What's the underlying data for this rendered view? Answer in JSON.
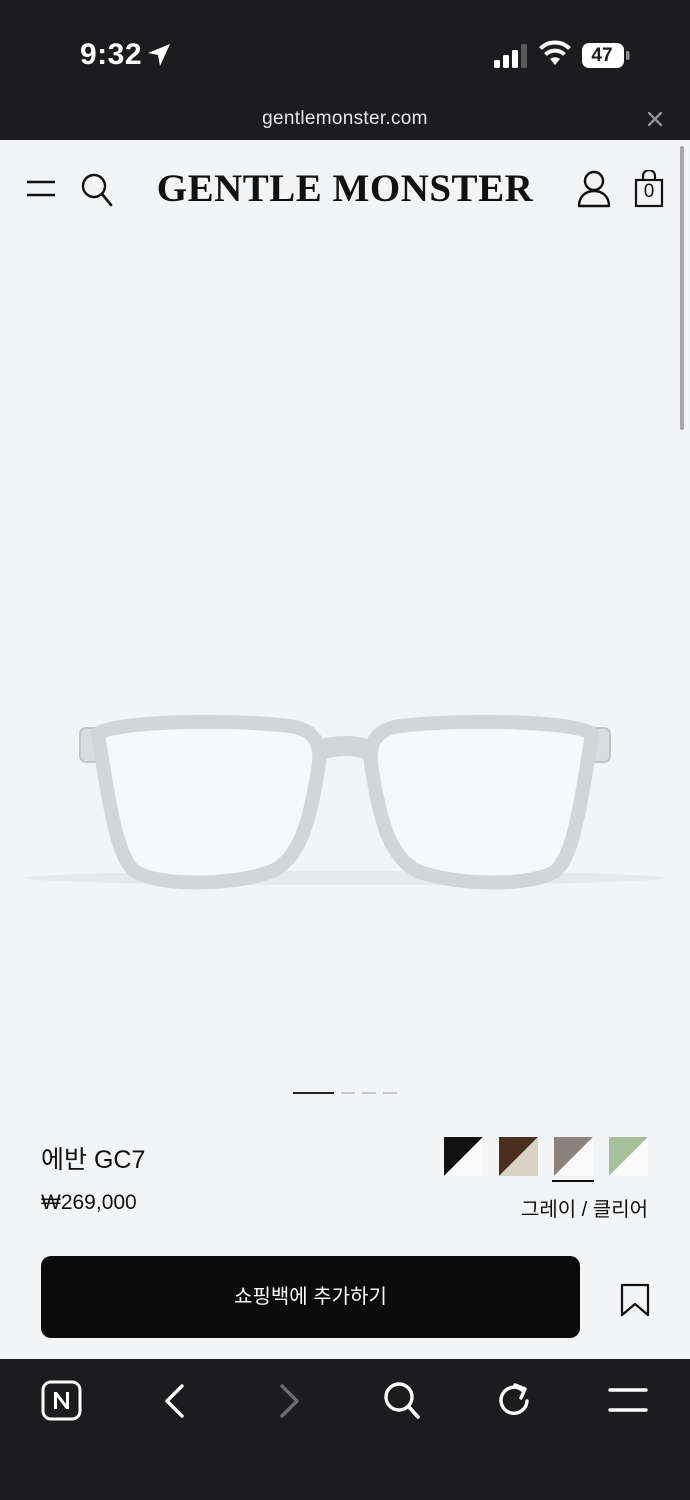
{
  "status_bar": {
    "time": "9:32",
    "battery": "47"
  },
  "url_bar": {
    "domain": "gentlemonster.com"
  },
  "header": {
    "brand": "GENTLE MONSTER",
    "bag_count": "0"
  },
  "carousel": {
    "slides": 4,
    "active_slide": 1
  },
  "product": {
    "name": "에반 GC7",
    "price": "₩269,000",
    "selected_color": "그레이 / 클리어",
    "color_options": [
      {
        "name": "black",
        "color": "#111111",
        "selected": false
      },
      {
        "name": "brown",
        "color": "#4a2f1f",
        "selected": false
      },
      {
        "name": "gray",
        "color": "#8a827c",
        "selected": true
      },
      {
        "name": "green",
        "color": "#a8c09a",
        "selected": false
      }
    ]
  },
  "actions": {
    "add_to_bag_label": "쇼핑백에 추가하기"
  },
  "toolbar": {
    "icons": [
      "naver-icon",
      "back-icon",
      "forward-icon",
      "search-icon",
      "reload-icon",
      "menu-icon"
    ]
  }
}
